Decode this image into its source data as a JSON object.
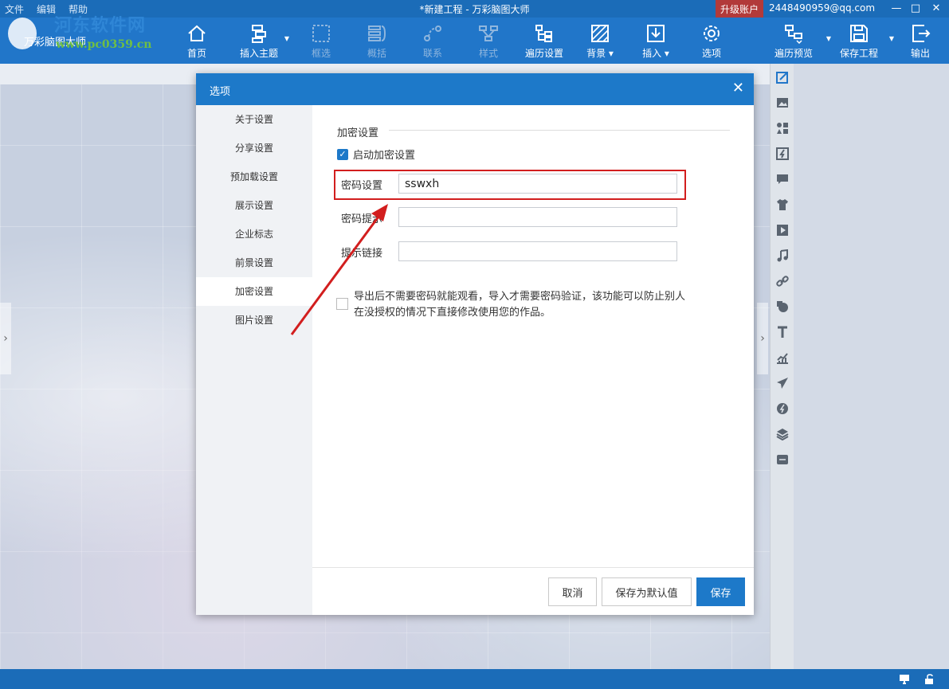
{
  "titlebar": {
    "menu": [
      "文件",
      "编辑",
      "帮助"
    ],
    "title": "*新建工程 - 万彩脑图大师",
    "upgrade": "升级账户",
    "account": "2448490959@qq.com",
    "min": "—",
    "max": "□",
    "close": "✕"
  },
  "logo": {
    "brand": "河东软件网",
    "site": "www.pc0359.cn",
    "appname": "万彩脑图大师"
  },
  "toolbar": {
    "home": "首页",
    "insert_topic": "插入主题",
    "select": "框选",
    "summary": "概括",
    "relation": "联系",
    "style": "样式",
    "traverse_settings": "遍历设置",
    "background": "背景",
    "insert": "插入",
    "options": "选项",
    "traverse_preview": "遍历预览",
    "save_project": "保存工程",
    "export": "输出"
  },
  "dialog": {
    "title": "选项",
    "close": "✕",
    "nav": [
      "关于设置",
      "分享设置",
      "预加载设置",
      "展示设置",
      "企业标志",
      "前景设置",
      "加密设置",
      "图片设置"
    ],
    "active_nav_index": 6,
    "section_title": "加密设置",
    "enable_label": "启动加密设置",
    "enable_checked": true,
    "password_label": "密码设置",
    "password_value": "sswxh",
    "hint_label": "密码提示",
    "hint_value": "",
    "link_label": "提示链接",
    "link_value": "",
    "note": "导出后不需要密码就能观看，导入才需要密码验证，该功能可以防止别人在没授权的情况下直接修改使用您的作品。",
    "note_checked": false,
    "buttons": {
      "cancel": "取消",
      "save_default": "保存为默认值",
      "save": "保存"
    }
  },
  "colors": {
    "titlebar": "#1b6cb8",
    "toolbar": "#2176c9",
    "accent": "#1d79c9",
    "highlight": "#d21e1e"
  }
}
